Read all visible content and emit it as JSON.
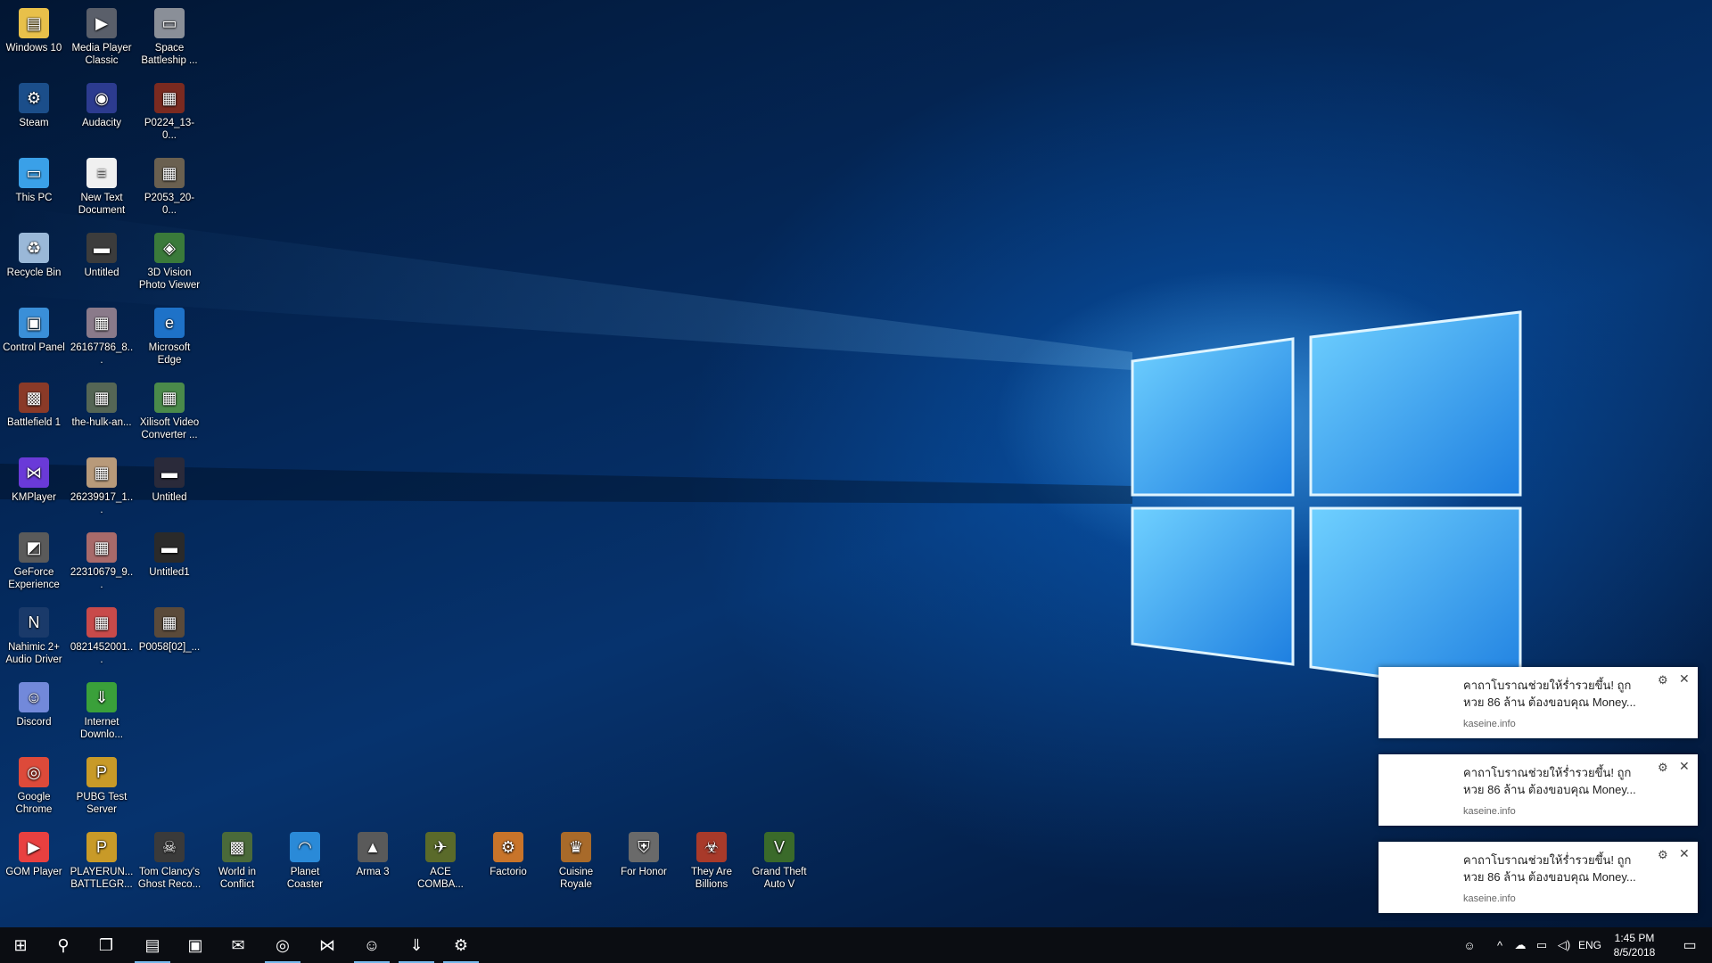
{
  "desktop_icons": [
    {
      "label": "Windows 10",
      "icon": "folder-icon",
      "color": "#e8c04a",
      "symbol": "▤"
    },
    {
      "label": "Media Player Classic",
      "icon": "media-player-icon",
      "color": "#5a5f6a",
      "symbol": "▶"
    },
    {
      "label": "Space Battleship ...",
      "icon": "game-shortcut-icon",
      "color": "#8a8f98",
      "symbol": "▭"
    },
    {
      "label": "Steam",
      "icon": "steam-icon",
      "color": "#1b4e8a",
      "symbol": "⚙"
    },
    {
      "label": "Audacity",
      "icon": "audacity-icon",
      "color": "#2c3b8f",
      "symbol": "◉"
    },
    {
      "label": "P0224_13-0...",
      "icon": "image-file-icon",
      "color": "#7a2a20",
      "symbol": "▦"
    },
    {
      "label": "This PC",
      "icon": "computer-icon",
      "color": "#3aa0e8",
      "symbol": "▭"
    },
    {
      "label": "New Text Document",
      "icon": "text-file-icon",
      "color": "#f0f0f0",
      "symbol": "≡"
    },
    {
      "label": "P2053_20-0...",
      "icon": "image-file-icon",
      "color": "#6a6050",
      "symbol": "▦"
    },
    {
      "label": "Recycle Bin",
      "icon": "recycle-bin-icon",
      "color": "#9ab8d8",
      "symbol": "♻"
    },
    {
      "label": "Untitled",
      "icon": "video-file-icon",
      "color": "#3c3c3c",
      "symbol": "▬"
    },
    {
      "label": "3D Vision Photo Viewer",
      "icon": "3d-vision-icon",
      "color": "#3a7a3a",
      "symbol": "◈"
    },
    {
      "label": "Control Panel",
      "icon": "control-panel-icon",
      "color": "#3a8fd8",
      "symbol": "▣"
    },
    {
      "label": "26167786_8...",
      "icon": "image-file-icon",
      "color": "#8a7a8a",
      "symbol": "▦"
    },
    {
      "label": "Microsoft Edge",
      "icon": "edge-icon",
      "color": "#1e72c8",
      "symbol": "e"
    },
    {
      "label": "Battlefield 1",
      "icon": "game-shortcut-icon",
      "color": "#8a3a28",
      "symbol": "▩"
    },
    {
      "label": "the-hulk-an...",
      "icon": "image-file-icon",
      "color": "#556655",
      "symbol": "▦"
    },
    {
      "label": "Xilisoft Video Converter ...",
      "icon": "video-converter-icon",
      "color": "#4a8a4a",
      "symbol": "▦"
    },
    {
      "label": "KMPlayer",
      "icon": "kmplayer-icon",
      "color": "#6a3ad8",
      "symbol": "⋈"
    },
    {
      "label": "26239917_1...",
      "icon": "image-file-icon",
      "color": "#b89a7a",
      "symbol": "▦"
    },
    {
      "label": "Untitled",
      "icon": "video-file-icon",
      "color": "#2a2a3a",
      "symbol": "▬"
    },
    {
      "label": "GeForce Experience",
      "icon": "geforce-icon",
      "color": "#5a5a5a",
      "symbol": "◩"
    },
    {
      "label": "22310679_9...",
      "icon": "image-file-icon",
      "color": "#a86a6a",
      "symbol": "▦"
    },
    {
      "label": "Untitled1",
      "icon": "video-file-icon",
      "color": "#2a2a2a",
      "symbol": "▬"
    },
    {
      "label": "Nahimic 2+ Audio Driver",
      "icon": "nahimic-icon",
      "color": "#1a3a6a",
      "symbol": "N"
    },
    {
      "label": "0821452001...",
      "icon": "image-file-icon",
      "color": "#c84a4a",
      "symbol": "▦"
    },
    {
      "label": "P0058[02]_...",
      "icon": "image-file-icon",
      "color": "#5a4a3a",
      "symbol": "▦"
    },
    {
      "label": "Discord",
      "icon": "discord-icon",
      "color": "#7289da",
      "symbol": "☺"
    },
    {
      "label": "Internet Downlo...",
      "icon": "idm-icon",
      "color": "#3aa03a",
      "symbol": "⇓"
    },
    {
      "label": "Google Chrome",
      "icon": "chrome-icon",
      "color": "#dd4a3a",
      "symbol": "◎"
    },
    {
      "label": "PUBG Test Server",
      "icon": "pubg-icon",
      "color": "#c89a28",
      "symbol": "P"
    },
    {
      "label": "GOM Player",
      "icon": "gom-player-icon",
      "color": "#e84040",
      "symbol": "▶"
    },
    {
      "label": "PLAYERUN... BATTLEGR...",
      "icon": "pubg-icon",
      "color": "#c89a28",
      "symbol": "P"
    },
    {
      "label": "Tom Clancy's Ghost Reco...",
      "icon": "game-shortcut-icon",
      "color": "#3a3a3a",
      "symbol": "☠"
    },
    {
      "label": "World in Conflict",
      "icon": "game-shortcut-icon",
      "color": "#4a6a3a",
      "symbol": "▩"
    },
    {
      "label": "Planet Coaster",
      "icon": "game-shortcut-icon",
      "color": "#2a8ad8",
      "symbol": "◠"
    },
    {
      "label": "Arma 3",
      "icon": "game-shortcut-icon",
      "color": "#5a5a5a",
      "symbol": "▲"
    },
    {
      "label": "ACE COMBA...",
      "icon": "game-shortcut-icon",
      "color": "#5a6a2a",
      "symbol": "✈"
    },
    {
      "label": "Factorio",
      "icon": "factorio-icon",
      "color": "#c8742a",
      "symbol": "⚙"
    },
    {
      "label": "Cuisine Royale",
      "icon": "game-shortcut-icon",
      "color": "#a86a2a",
      "symbol": "♛"
    },
    {
      "label": "For Honor",
      "icon": "for-honor-icon",
      "color": "#6a6a6a",
      "symbol": "⛨"
    },
    {
      "label": "They Are Billions",
      "icon": "game-shortcut-icon",
      "color": "#a83a2a",
      "symbol": "☣"
    },
    {
      "label": "Grand Theft Auto V",
      "icon": "gta-icon",
      "color": "#3a6a2a",
      "symbol": "V"
    }
  ],
  "notifications": [
    {
      "message": "คาถาโบราณช่วยให้ร่ำรวยขึ้น! ถูกหวย 86 ล้าน ต้องขอบคุณ Money...",
      "source": "kaseine.info"
    },
    {
      "message": "คาถาโบราณช่วยให้ร่ำรวยขึ้น! ถูกหวย 86 ล้าน ต้องขอบคุณ Money...",
      "source": "kaseine.info"
    },
    {
      "message": "คาถาโบราณช่วยให้ร่ำรวยขึ้น! ถูกหวย 86 ล้าน ต้องขอบคุณ Money...",
      "source": "kaseine.info"
    }
  ],
  "taskbar": {
    "buttons": [
      {
        "name": "start-button",
        "icon": "windows-logo-icon",
        "symbol": "⊞",
        "active": false
      },
      {
        "name": "search-button",
        "icon": "search-icon",
        "symbol": "⚲",
        "active": false
      },
      {
        "name": "task-view-button",
        "icon": "task-view-icon",
        "symbol": "❐",
        "active": false
      },
      {
        "name": "file-explorer-button",
        "icon": "folder-icon",
        "symbol": "▤",
        "active": true
      },
      {
        "name": "store-button",
        "icon": "store-icon",
        "symbol": "▣",
        "active": false
      },
      {
        "name": "mail-button",
        "icon": "mail-icon",
        "symbol": "✉",
        "active": false
      },
      {
        "name": "chrome-button",
        "icon": "chrome-icon",
        "symbol": "◎",
        "active": true
      },
      {
        "name": "kmplayer-button",
        "icon": "kmplayer-icon",
        "symbol": "⋈",
        "active": false
      },
      {
        "name": "discord-button",
        "icon": "discord-icon",
        "symbol": "☺",
        "active": true
      },
      {
        "name": "idm-button",
        "icon": "idm-icon",
        "symbol": "⇓",
        "active": true
      },
      {
        "name": "steam-button",
        "icon": "steam-icon",
        "symbol": "⚙",
        "active": true
      }
    ],
    "tray": {
      "people_icon": "☺",
      "chevron": "^",
      "onedrive": "☁",
      "network": "▭",
      "volume": "◁)",
      "language": "ENG",
      "time": "1:45 PM",
      "date": "8/5/2018",
      "action_center": "▭"
    }
  }
}
